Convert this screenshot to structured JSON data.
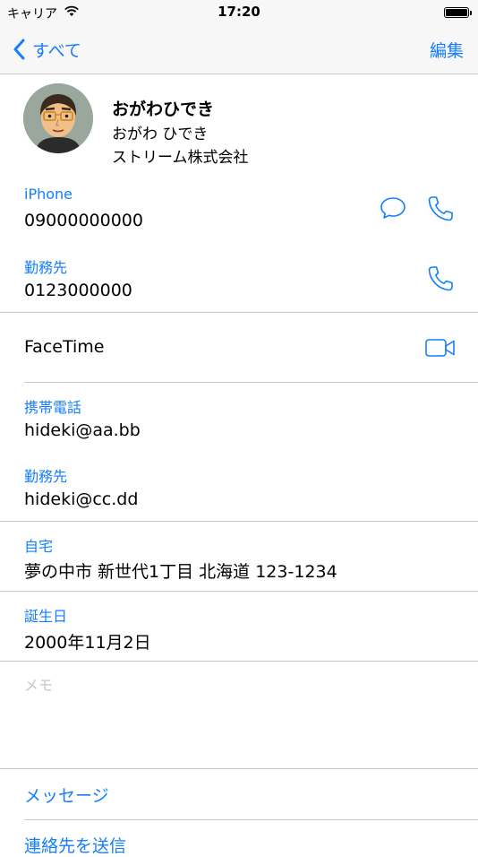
{
  "status_bar": {
    "carrier": "キャリア",
    "time": "17:20"
  },
  "nav": {
    "back_label": "すべて",
    "edit_label": "編集"
  },
  "contact": {
    "name": "おがわひでき",
    "phonetic": "おがわ ひでき",
    "company": "ストリーム株式会社"
  },
  "phones": [
    {
      "label": "iPhone",
      "value": "09000000000"
    },
    {
      "label": "勤務先",
      "value": "0123000000"
    }
  ],
  "facetime": {
    "label": "FaceTime"
  },
  "emails": [
    {
      "label": "携帯電話",
      "value": "hideki@aa.bb"
    },
    {
      "label": "勤務先",
      "value": "hideki@cc.dd"
    }
  ],
  "address": {
    "label": "自宅",
    "value": "夢の中市 新世代1丁目 北海道 123-1234"
  },
  "birthday": {
    "label": "誕生日",
    "value": "2000年11月2日"
  },
  "memo": {
    "placeholder": "メモ"
  },
  "actions": {
    "message": "メッセージ",
    "send_contact": "連絡先を送信"
  },
  "colors": {
    "accent": "#147efb",
    "separator": "#c8c7cc",
    "nav_bg": "#f7f7f7",
    "placeholder": "#c7c7cc"
  }
}
